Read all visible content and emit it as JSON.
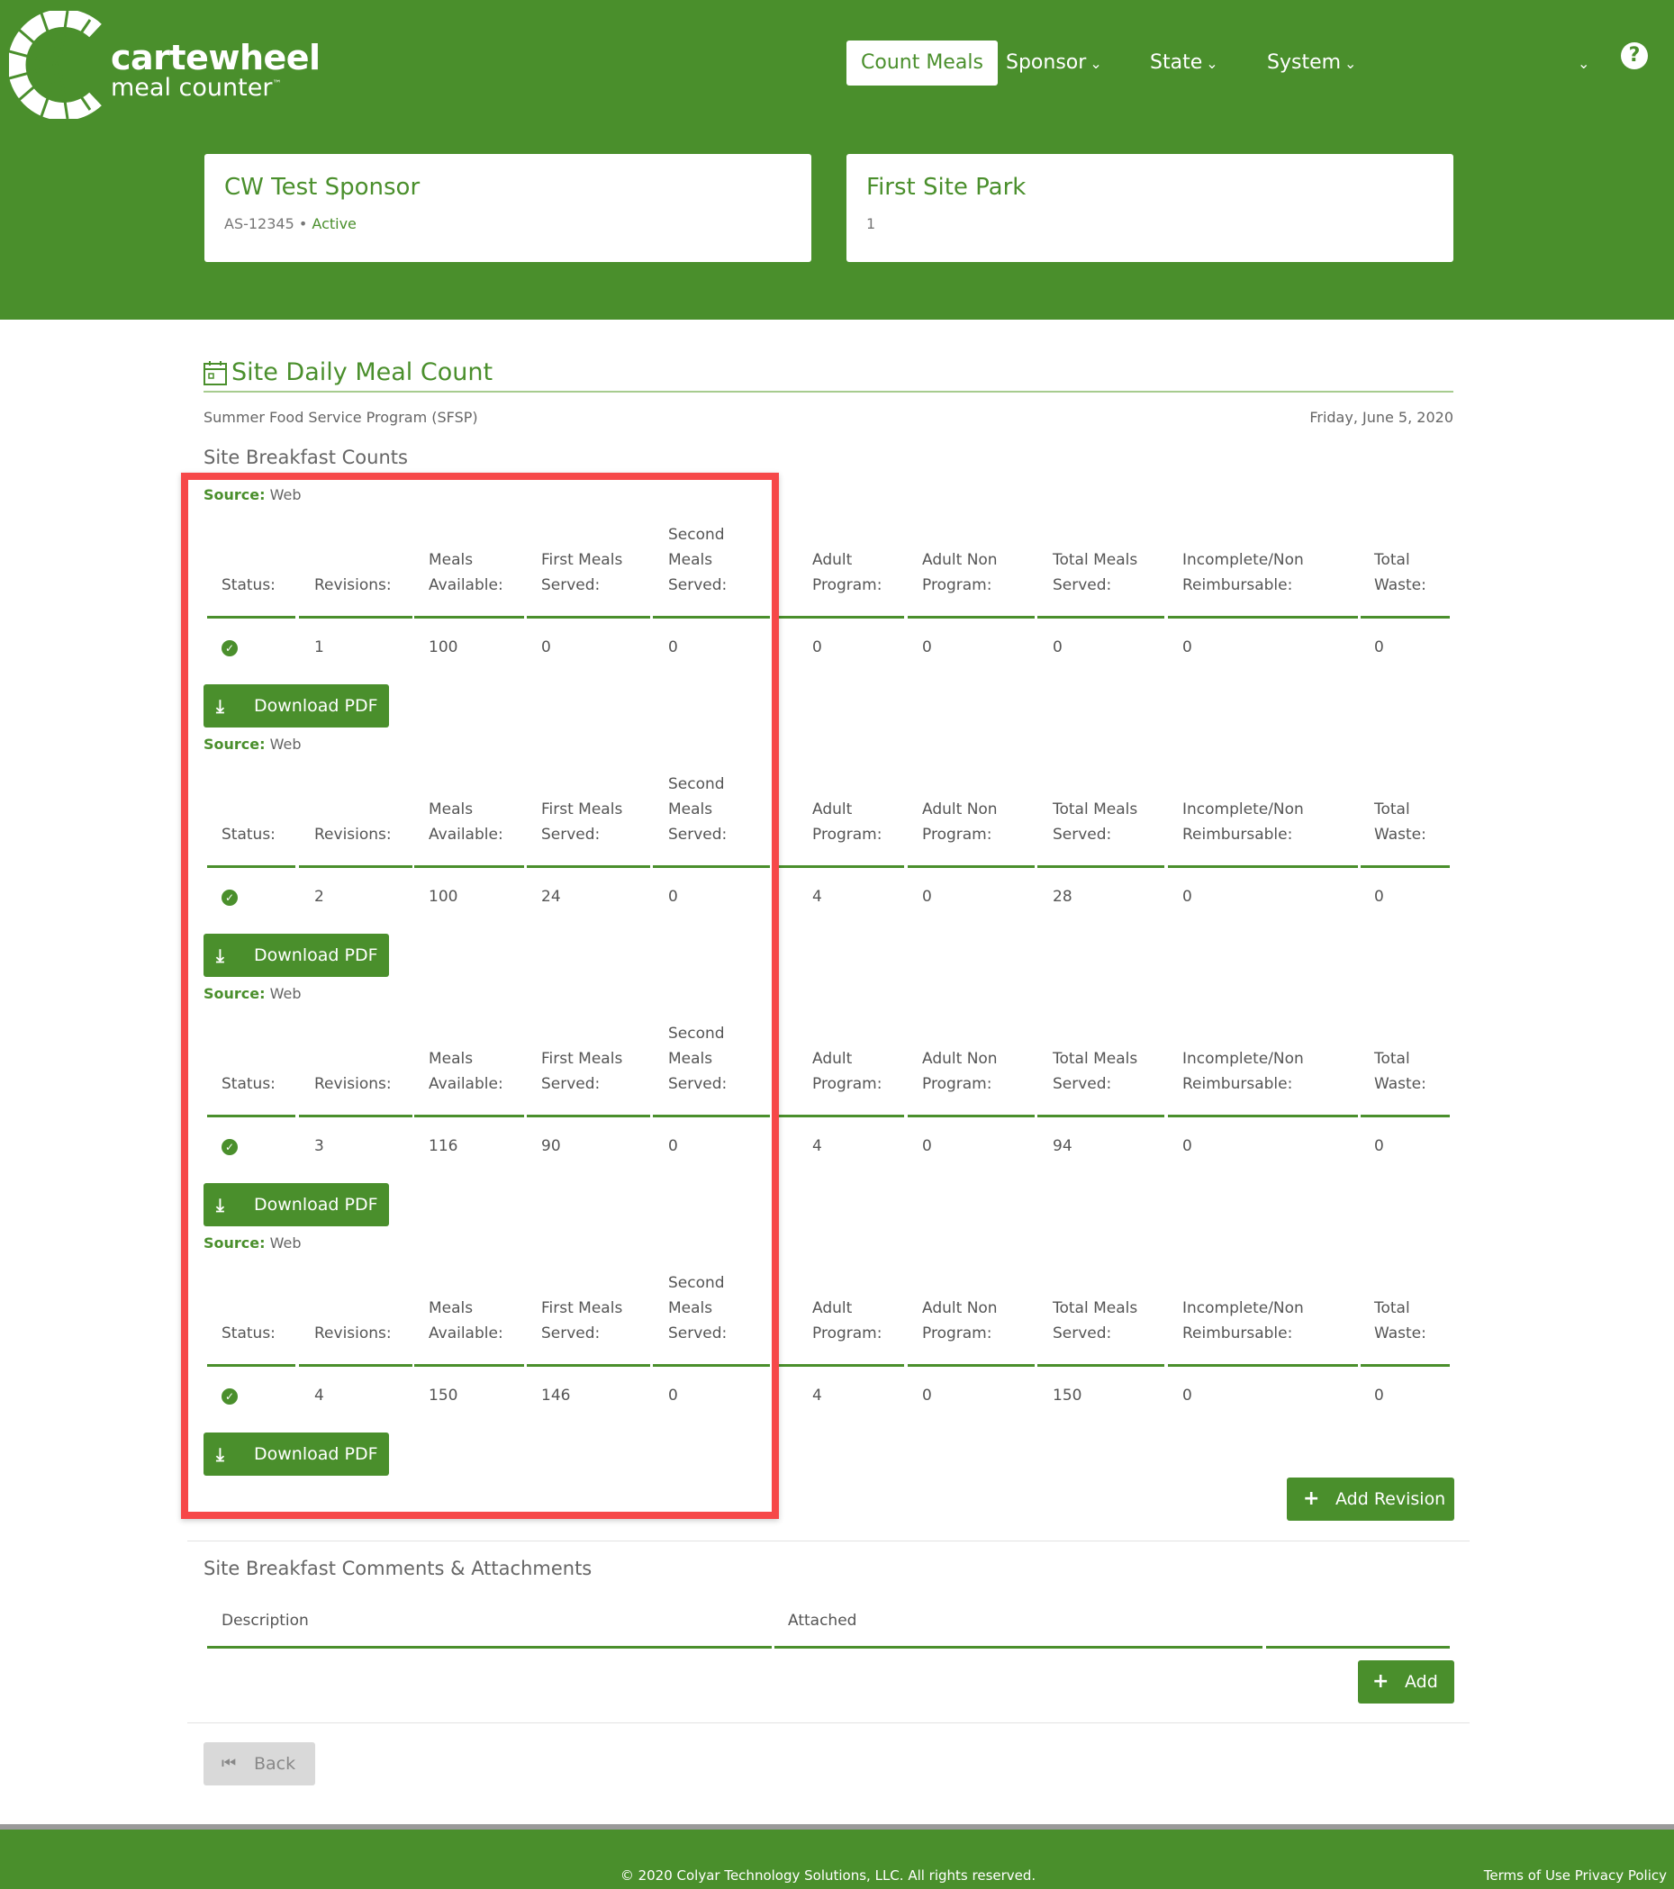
{
  "brand": {
    "title": "cartewheel",
    "subtitle": "meal counter",
    "trademark": "™",
    "accent_color": "#4a8f2c",
    "highlight_color": "#f64849"
  },
  "nav": {
    "count_meals": "Count Meals",
    "sponsor": "Sponsor",
    "state": "State",
    "system": "System",
    "user_menu_icon": "chevron-down-icon",
    "help": "?"
  },
  "sponsor_card": {
    "name": "CW Test Sponsor",
    "code": "AS-12345",
    "separator": "•",
    "status": "Active"
  },
  "site_card": {
    "name": "First Site Park",
    "number": "1"
  },
  "page": {
    "title": "Site Daily Meal Count",
    "program": "Summer Food Service Program (SFSP)",
    "date": "Friday, June 5, 2020",
    "section": "Site Breakfast Counts"
  },
  "source_label": "Source:",
  "source_value": "Web",
  "headers": {
    "status": [
      "Status:"
    ],
    "revisions": [
      "Revisions:"
    ],
    "meals_available": [
      "Meals",
      "Available:"
    ],
    "first_meals": [
      "First Meals",
      "Served:"
    ],
    "second_meals": [
      "Second",
      "Meals",
      "Served:"
    ],
    "adult_program": [
      "Adult",
      "Program:"
    ],
    "adult_non_program": [
      "Adult Non",
      "Program:"
    ],
    "total_meals": [
      "Total Meals",
      "Served:"
    ],
    "incomplete": [
      "Incomplete/Non",
      "Reimbursable:"
    ],
    "total_waste": [
      "Total",
      "Waste:"
    ]
  },
  "revisions": [
    {
      "revision": "1",
      "meals_available": "100",
      "first_meals": "0",
      "second_meals": "0",
      "adult_program": "0",
      "adult_non_program": "0",
      "total_meals": "0",
      "incomplete": "0",
      "total_waste": "0"
    },
    {
      "revision": "2",
      "meals_available": "100",
      "first_meals": "24",
      "second_meals": "0",
      "adult_program": "4",
      "adult_non_program": "0",
      "total_meals": "28",
      "incomplete": "0",
      "total_waste": "0"
    },
    {
      "revision": "3",
      "meals_available": "116",
      "first_meals": "90",
      "second_meals": "0",
      "adult_program": "4",
      "adult_non_program": "0",
      "total_meals": "94",
      "incomplete": "0",
      "total_waste": "0"
    },
    {
      "revision": "4",
      "meals_available": "150",
      "first_meals": "146",
      "second_meals": "0",
      "adult_program": "4",
      "adult_non_program": "0",
      "total_meals": "150",
      "incomplete": "0",
      "total_waste": "0"
    }
  ],
  "buttons": {
    "download_pdf": "Download PDF",
    "add_revision": "Add Revision",
    "add": "Add",
    "back": "Back"
  },
  "comments": {
    "title": "Site Breakfast Comments & Attachments",
    "col_description": "Description",
    "col_attached": "Attached"
  },
  "footer": {
    "copyright": "© 2020 Colyar Technology Solutions, LLC. All rights reserved.",
    "terms": "Terms of Use",
    "privacy": "Privacy Policy"
  }
}
